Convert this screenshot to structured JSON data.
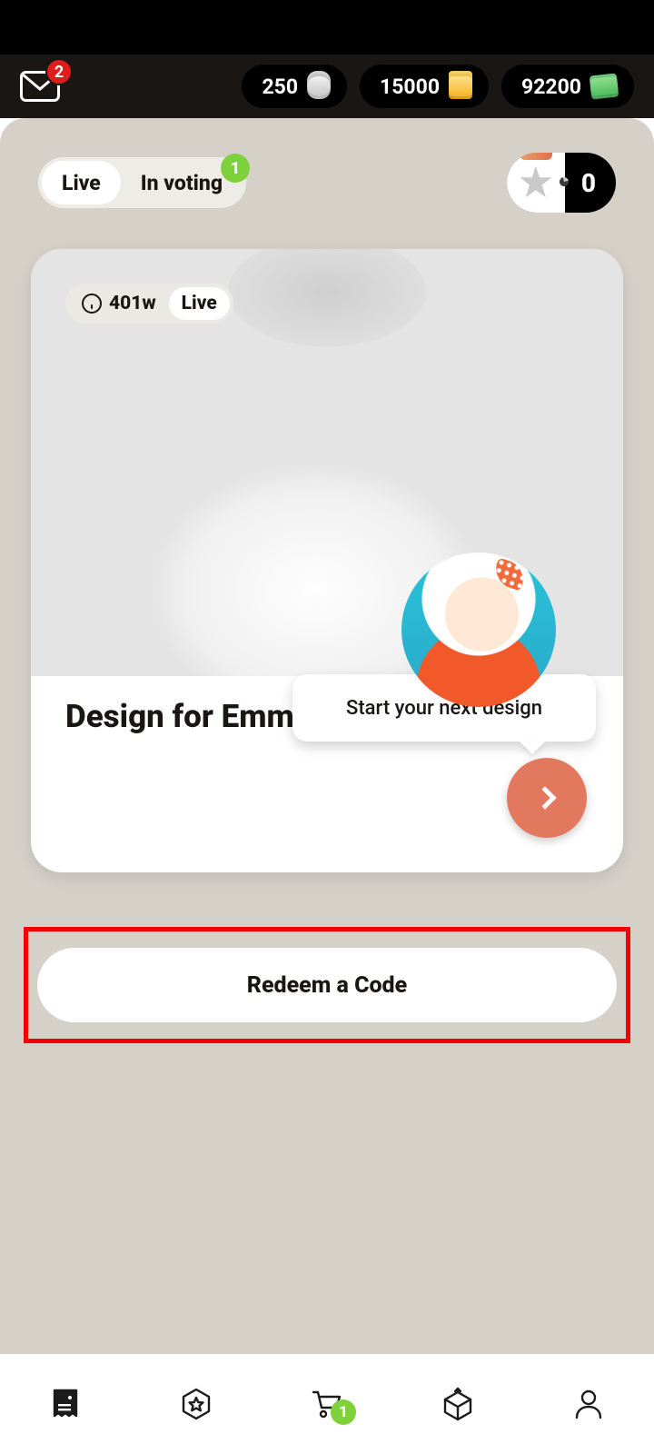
{
  "header": {
    "mail_badge": "2",
    "currencies": [
      {
        "amount": "250",
        "icon": "coin-stack-icon"
      },
      {
        "amount": "15000",
        "icon": "gold-stack-icon"
      },
      {
        "amount": "92200",
        "icon": "cash-stack-icon"
      }
    ]
  },
  "tabs": {
    "live_label": "Live",
    "voting_label": "In voting",
    "voting_badge": "1"
  },
  "star_chip": {
    "count": "0"
  },
  "card": {
    "time_badge": "401w",
    "status_badge": "Live",
    "title": "Design for Emma",
    "bubble_text": "Start your next design"
  },
  "redeem": {
    "label": "Redeem a Code"
  },
  "nav": {
    "cart_badge": "1",
    "items": [
      "receipt",
      "star-badge",
      "cart",
      "box",
      "profile"
    ]
  }
}
